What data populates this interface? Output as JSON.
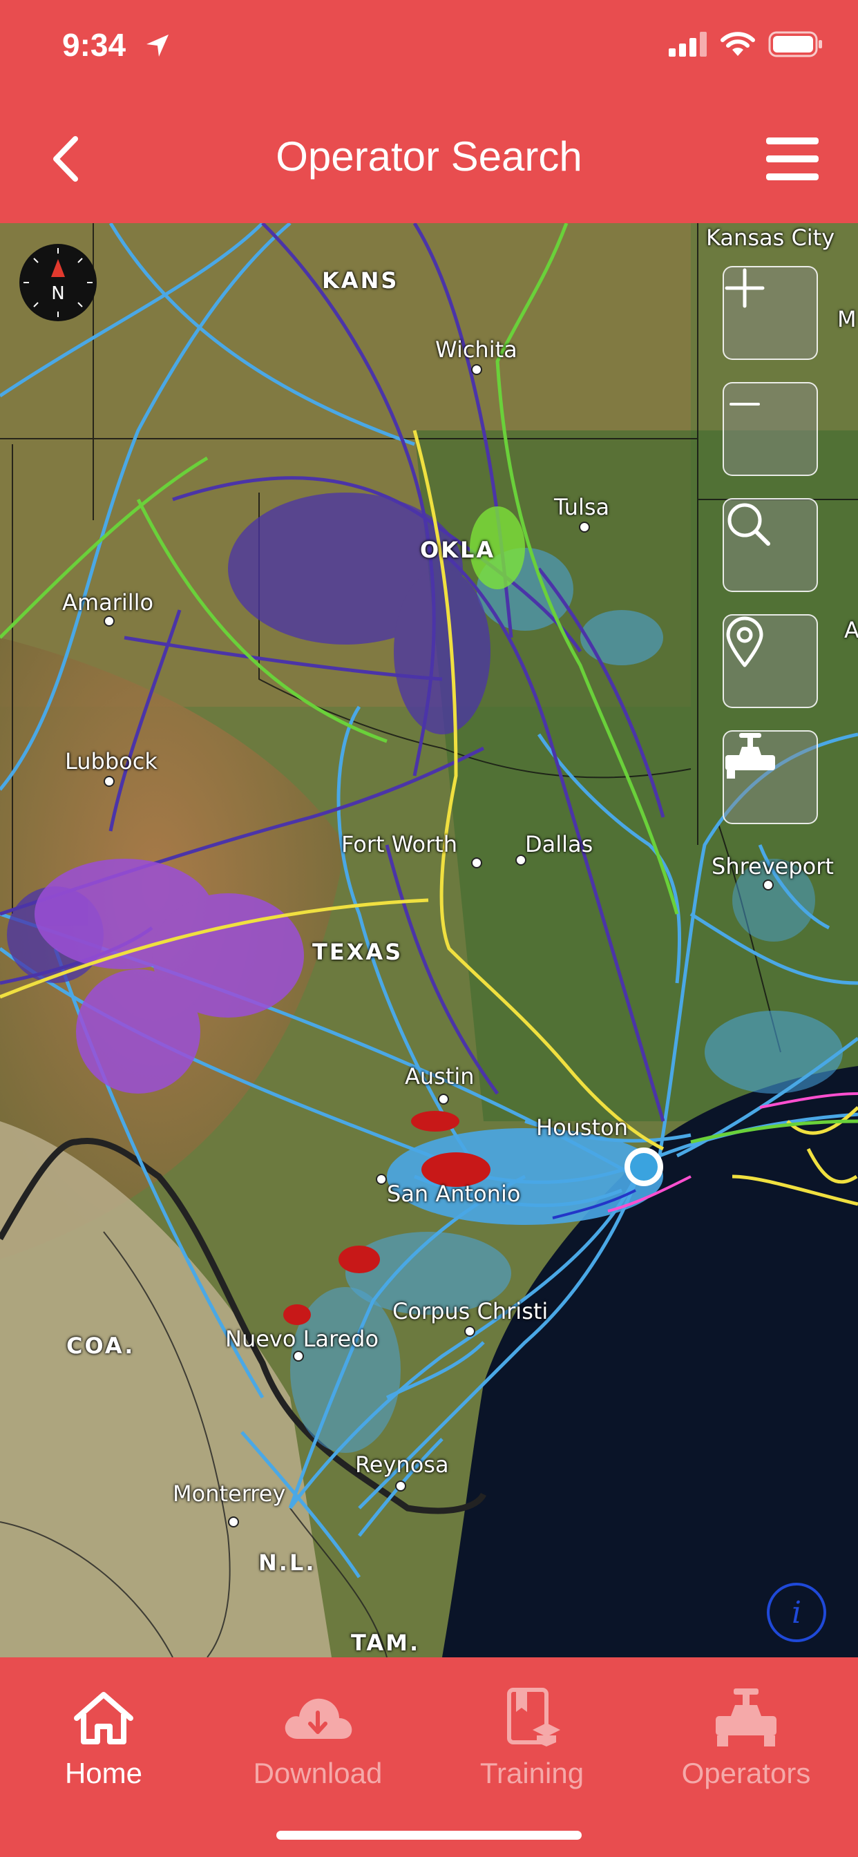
{
  "status_bar": {
    "time": "9:34"
  },
  "nav": {
    "title": "Operator Search"
  },
  "map": {
    "compass_letter": "N",
    "info_symbol": "i",
    "labels": {
      "kansas_city": "Kansas City",
      "edge_m": "M",
      "edge_a": "A",
      "kansas": "KANS",
      "wichita": "Wichita",
      "tulsa": "Tulsa",
      "okla": "OKLA",
      "amarillo": "Amarillo",
      "lubbock": "Lubbock",
      "fort_worth": "Fort Worth",
      "dallas": "Dallas",
      "shreveport": "Shreveport",
      "texas": "TEXAS",
      "austin": "Austin",
      "houston": "Houston",
      "san_antonio": "San Antonio",
      "corpus_christi": "Corpus Christi",
      "coa": "COA.",
      "nuevo_laredo": "Nuevo Laredo",
      "reynosa": "Reynosa",
      "monterrey": "Monterrey",
      "nl": "N.L.",
      "tam": "TAM."
    },
    "controls": [
      "zoom-in",
      "zoom-out",
      "search",
      "location",
      "pipeline-valve"
    ]
  },
  "tabs": [
    {
      "label": "Home",
      "icon": "home-icon",
      "active": true
    },
    {
      "label": "Download",
      "icon": "cloud-download-icon",
      "active": false
    },
    {
      "label": "Training",
      "icon": "training-book-icon",
      "active": false
    },
    {
      "label": "Operators",
      "icon": "pipeline-valve-icon",
      "active": false
    }
  ],
  "colors": {
    "brand": "#e84d4f",
    "pipeline_light_blue": "#4aa8e6",
    "pipeline_purple": "#4b34a8",
    "pipeline_violet": "#9a4fd6",
    "pipeline_yellow": "#f0e040",
    "pipeline_green": "#6ad13a",
    "pipeline_red": "#c81818",
    "water": "#0a1428"
  }
}
